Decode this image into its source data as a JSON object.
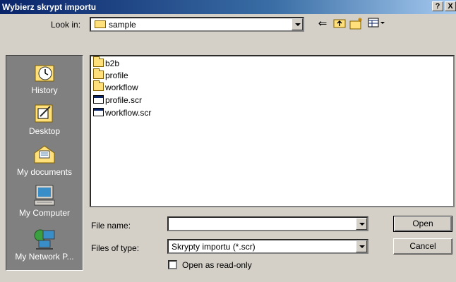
{
  "dialog": {
    "title": "Wybierz skrypt importu",
    "help_label": "?",
    "close_label": "X"
  },
  "toolbar": {
    "look_in_label": "Look in:",
    "look_in_value": "sample"
  },
  "places": [
    {
      "label": "History",
      "icon": "history-icon"
    },
    {
      "label": "Desktop",
      "icon": "desktop-icon"
    },
    {
      "label": "My documents",
      "icon": "my-documents-icon"
    },
    {
      "label": "My Computer",
      "icon": "my-computer-icon"
    },
    {
      "label": "My Network P...",
      "icon": "network-places-icon"
    }
  ],
  "files": [
    {
      "name": "b2b",
      "type": "folder"
    },
    {
      "name": "profile",
      "type": "folder"
    },
    {
      "name": "workflow",
      "type": "folder"
    },
    {
      "name": "profile.scr",
      "type": "file"
    },
    {
      "name": "workflow.scr",
      "type": "file"
    }
  ],
  "form": {
    "file_name_label": "File name:",
    "file_name_value": "",
    "files_of_type_label": "Files of type:",
    "files_of_type_value": "Skrypty importu (*.scr)",
    "read_only_label": "Open as read-only",
    "open_label": "Open",
    "cancel_label": "Cancel"
  }
}
